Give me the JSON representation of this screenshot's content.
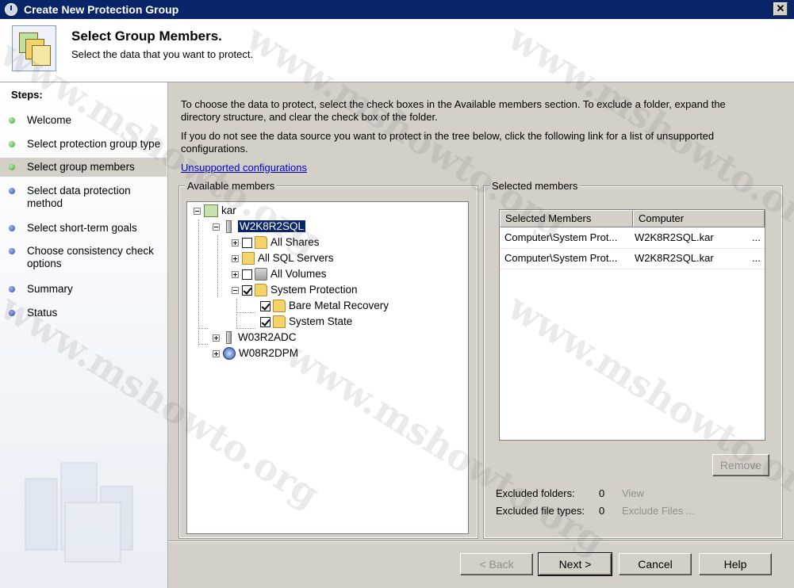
{
  "window": {
    "title": "Create New Protection Group",
    "close_glyph": "✕"
  },
  "header": {
    "title": "Select Group Members.",
    "subtitle": "Select the data that you want to protect."
  },
  "sidebar": {
    "title": "Steps:",
    "steps": [
      {
        "label": "Welcome",
        "state": "done"
      },
      {
        "label": "Select protection group type",
        "state": "done"
      },
      {
        "label": "Select group members",
        "state": "current"
      },
      {
        "label": "Select data protection method",
        "state": "todo"
      },
      {
        "label": "Select short-term goals",
        "state": "todo"
      },
      {
        "label": "Choose consistency check options",
        "state": "todo"
      },
      {
        "label": "Summary",
        "state": "todo"
      },
      {
        "label": "Status",
        "state": "todo"
      }
    ]
  },
  "instructions": {
    "p1": "To choose the data to protect, select the check boxes in the Available members section. To exclude a folder, expand the directory structure, and clear the check box of the folder.",
    "p2": "If you do not see the data source you want to protect in the tree below, click the following link for a list of unsupported configurations.",
    "link": "Unsupported configurations"
  },
  "available": {
    "label": "Available members",
    "tree": [
      {
        "label": "kar",
        "icon": "domain-icon",
        "expander": "minus",
        "checkbox": null
      },
      {
        "label": "W2K8R2SQL",
        "icon": "server-icon",
        "expander": "minus",
        "checkbox": null,
        "selected": true
      },
      {
        "label": "All Shares",
        "icon": "shares-icon",
        "expander": "plus",
        "checkbox": "unchecked"
      },
      {
        "label": "All SQL Servers",
        "icon": "sql-icon",
        "expander": "plus",
        "checkbox": null
      },
      {
        "label": "All Volumes",
        "icon": "volumes-icon",
        "expander": "plus",
        "checkbox": "unchecked"
      },
      {
        "label": "System Protection",
        "icon": "system-protection-icon",
        "expander": "minus",
        "checkbox": "checked"
      },
      {
        "label": "Bare Metal Recovery",
        "icon": "bmr-icon",
        "expander": null,
        "checkbox": "checked"
      },
      {
        "label": "System State",
        "icon": "system-state-icon",
        "expander": null,
        "checkbox": "checked"
      },
      {
        "label": "W03R2ADC",
        "icon": "server-icon",
        "expander": "plus",
        "checkbox": null
      },
      {
        "label": "W08R2DPM",
        "icon": "dpm-icon",
        "expander": "plus",
        "checkbox": null
      }
    ]
  },
  "selected": {
    "label": "Selected members",
    "columns": [
      "Selected Members",
      "Computer"
    ],
    "rows": [
      {
        "member": "Computer\\System  Prot...",
        "computer": "W2K8R2SQL.kar",
        "tail": "..."
      },
      {
        "member": "Computer\\System  Prot...",
        "computer": "W2K8R2SQL.kar",
        "tail": "..."
      }
    ],
    "remove_label": "Remove"
  },
  "exclusions": {
    "folders_label": "Excluded folders:",
    "folders_count": "0",
    "folders_action": "View",
    "types_label": "Excluded file types:",
    "types_count": "0",
    "types_action": "Exclude Files ..."
  },
  "buttons": {
    "back": "< Back",
    "next": "Next >",
    "cancel": "Cancel",
    "help": "Help"
  },
  "watermark": "www.mshowto.org"
}
